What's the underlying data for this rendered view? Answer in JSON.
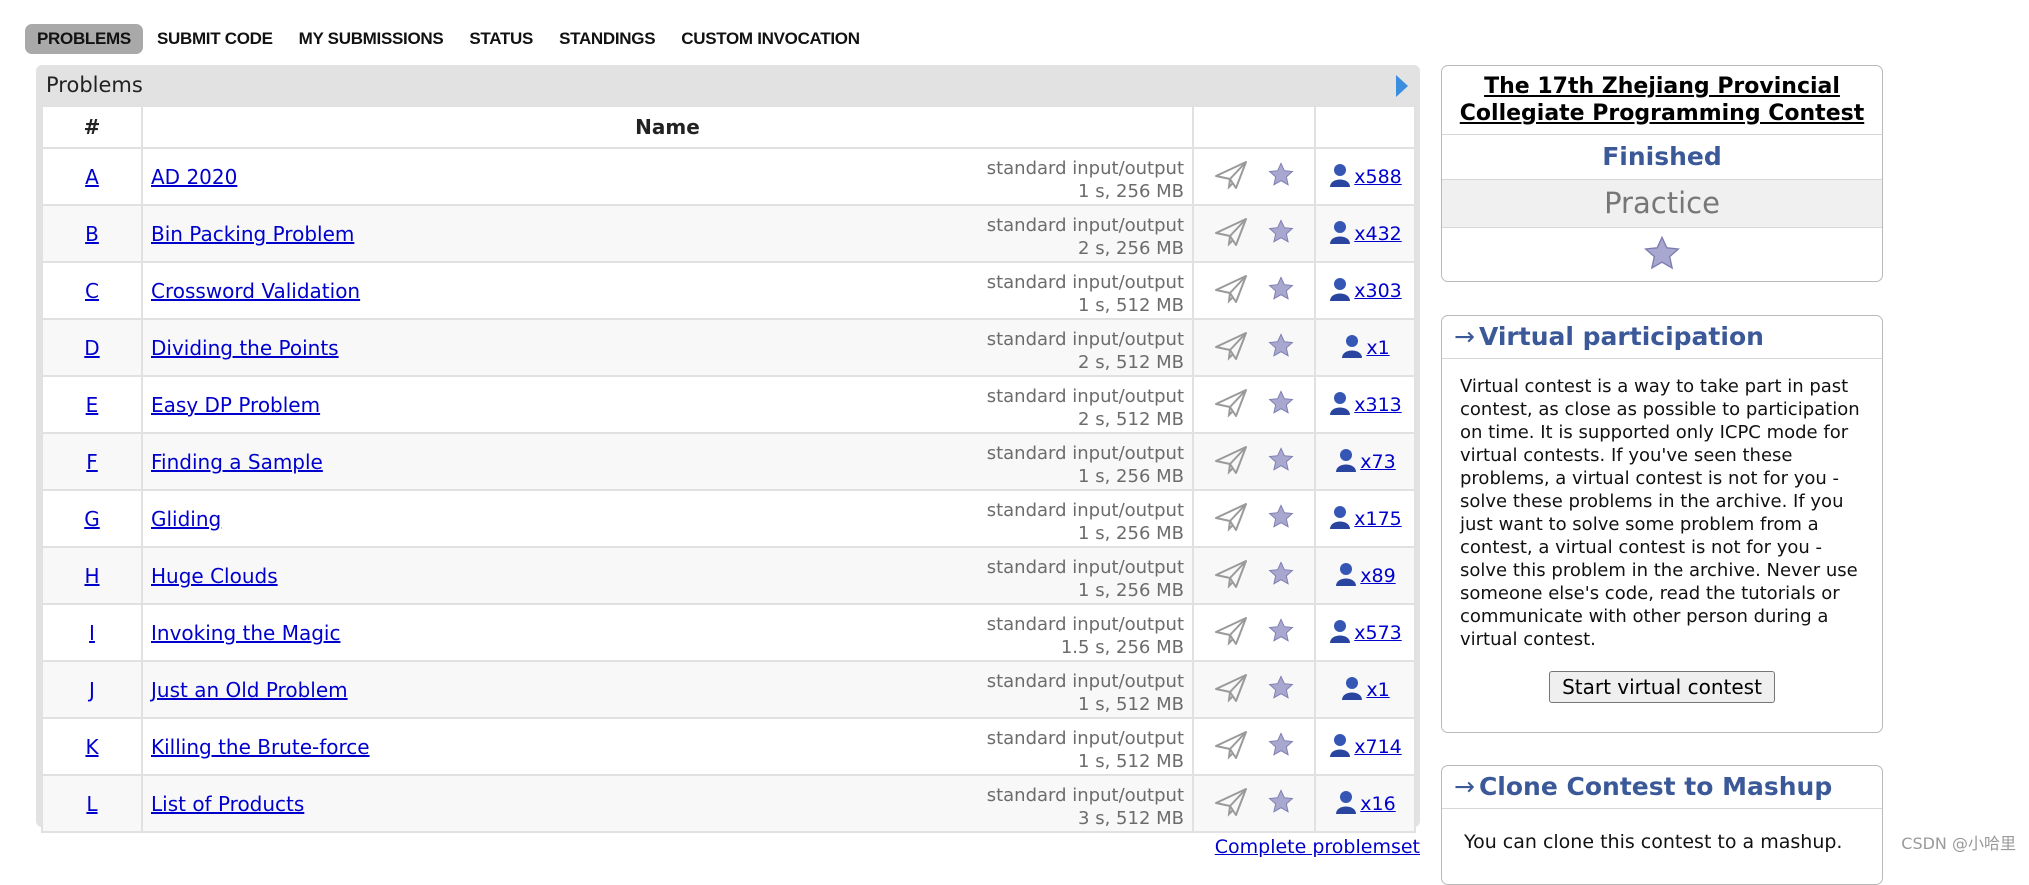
{
  "nav": {
    "items": [
      "PROBLEMS",
      "SUBMIT CODE",
      "MY SUBMISSIONS",
      "STATUS",
      "STANDINGS",
      "CUSTOM INVOCATION"
    ],
    "active_index": 0
  },
  "problems": {
    "caption": "Problems",
    "headers": {
      "index": "#",
      "name": "Name"
    },
    "rows": [
      {
        "index": "A",
        "name": "AD 2020",
        "io": "standard input/output",
        "limits": "1 s, 256 MB",
        "solved": "x588"
      },
      {
        "index": "B",
        "name": "Bin Packing Problem",
        "io": "standard input/output",
        "limits": "2 s, 256 MB",
        "solved": "x432"
      },
      {
        "index": "C",
        "name": "Crossword Validation",
        "io": "standard input/output",
        "limits": "1 s, 512 MB",
        "solved": "x303"
      },
      {
        "index": "D",
        "name": "Dividing the Points",
        "io": "standard input/output",
        "limits": "2 s, 512 MB",
        "solved": "x1"
      },
      {
        "index": "E",
        "name": "Easy DP Problem",
        "io": "standard input/output",
        "limits": "2 s, 512 MB",
        "solved": "x313"
      },
      {
        "index": "F",
        "name": "Finding a Sample",
        "io": "standard input/output",
        "limits": "1 s, 256 MB",
        "solved": "x73"
      },
      {
        "index": "G",
        "name": "Gliding",
        "io": "standard input/output",
        "limits": "1 s, 256 MB",
        "solved": "x175"
      },
      {
        "index": "H",
        "name": "Huge Clouds",
        "io": "standard input/output",
        "limits": "1 s, 256 MB",
        "solved": "x89"
      },
      {
        "index": "I",
        "name": "Invoking the Magic",
        "io": "standard input/output",
        "limits": "1.5 s, 256 MB",
        "solved": "x573"
      },
      {
        "index": "J",
        "name": "Just an Old Problem",
        "io": "standard input/output",
        "limits": "1 s, 512 MB",
        "solved": "x1"
      },
      {
        "index": "K",
        "name": "Killing the Brute-force",
        "io": "standard input/output",
        "limits": "1 s, 512 MB",
        "solved": "x714"
      },
      {
        "index": "L",
        "name": "List of Products",
        "io": "standard input/output",
        "limits": "3 s, 512 MB",
        "solved": "x16"
      }
    ],
    "complete_link": "Complete problemset"
  },
  "sidebar": {
    "contest": {
      "title": "The 17th Zhejiang Provincial Collegiate Programming Contest",
      "status": "Finished",
      "phase": "Practice"
    },
    "virtual": {
      "title": "Virtual participation",
      "arrow": "→",
      "text": "Virtual contest is a way to take part in past contest, as close as possible to participation on time. It is supported only ICPC mode for virtual contests. If you've seen these problems, a virtual contest is not for you - solve these problems in the archive. If you just want to solve some problem from a contest, a virtual contest is not for you - solve this problem in the archive. Never use someone else's code, read the tutorials or communicate with other person during a virtual contest.",
      "button": "Start virtual contest"
    },
    "clone": {
      "title": "Clone Contest to Mashup",
      "arrow": "→",
      "text": "You can clone this contest to a mashup."
    }
  },
  "watermark": "CSDN @小哈里",
  "colors": {
    "link": "#0000cc",
    "sidebar_heading": "#3b5998",
    "nav_active": "#a9a9a9",
    "box_bg": "#e2e2e2"
  },
  "icons": {
    "caption_toggle": "triangle-right-icon",
    "submit": "paper-plane-icon",
    "favourite": "star-icon",
    "solvers": "user-icon"
  }
}
